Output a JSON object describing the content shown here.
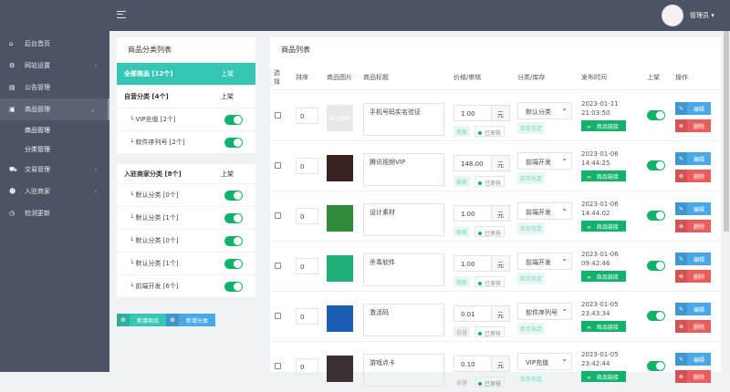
{
  "header": {
    "user": "管理员 ▾"
  },
  "sidebar": {
    "items": [
      {
        "label": "后台首页",
        "icon": "⌂",
        "name": "home",
        "chev": ""
      },
      {
        "label": "网站设置",
        "icon": "⚙",
        "name": "settings",
        "chev": "›"
      },
      {
        "label": "公告管理",
        "icon": "▤",
        "name": "notice",
        "chev": ""
      },
      {
        "label": "商品管理",
        "icon": "▣",
        "name": "goods",
        "chev": "⌄",
        "active": true
      },
      {
        "label": "交易管理",
        "icon": "⛟",
        "name": "trade",
        "chev": "›"
      },
      {
        "label": "入驻商家",
        "icon": "☻",
        "name": "merchant",
        "chev": "›"
      },
      {
        "label": "检测更新",
        "icon": "◷",
        "name": "update",
        "chev": ""
      }
    ],
    "sub": [
      "商品管理",
      "分类管理"
    ]
  },
  "category_card": {
    "title": "商品分类列表",
    "all": {
      "label": "全部商品 [12个]",
      "status": "上架"
    },
    "self": {
      "label": "自营分类 [4个]",
      "status": "上架",
      "children": [
        "└ VIP充值 [2个]",
        "└ 软件序列号 [2个]"
      ]
    },
    "merchant": {
      "label": "入驻商家分类 [8个]",
      "status": "上架",
      "children": [
        "└ 默认分类 [0个]",
        "└ 默认分类 [1个]",
        "└ 默认分类 [0个]",
        "└ 默认分类 [1个]",
        "└ 前端开发 [6个]"
      ]
    },
    "add_goods": "新增商品",
    "add_category": "新增分类"
  },
  "goods_card": {
    "title": "商品列表",
    "columns": [
      "选择",
      "排序",
      "商品图片",
      "商品标题",
      "价格/审核",
      "分类/库存",
      "发布时间",
      "上架",
      "操作"
    ],
    "unit": "元",
    "edit": "编辑",
    "delete": "删除",
    "link": "商品链接",
    "audit": "已审核",
    "stock": "库存充足",
    "rows": [
      {
        "sort": "0",
        "title": "手机号码实名验证",
        "price": "1.00",
        "source": "商家",
        "category": "默认分类",
        "date": "2023-01-11",
        "time": "21:03:50",
        "thumb": "默认图片",
        "color": "#e8e8e8"
      },
      {
        "sort": "0",
        "title": "腾讯视频VIP",
        "price": "148.00",
        "source": "商家",
        "category": "前端开发",
        "date": "2023-01-06",
        "time": "14:44:25",
        "thumb": "",
        "color": "#3a2220"
      },
      {
        "sort": "0",
        "title": "设计素材",
        "price": "1.00",
        "source": "商家",
        "category": "前端开发",
        "date": "2023-01-06",
        "time": "14:44:02",
        "thumb": "",
        "color": "#2f8a3a"
      },
      {
        "sort": "0",
        "title": "杀毒软件",
        "price": "1.00",
        "source": "商家",
        "category": "前端开发",
        "date": "2023-01-06",
        "time": "09:42:46",
        "thumb": "",
        "color": "#1fae78"
      },
      {
        "sort": "0",
        "title": "激活码",
        "price": "0.01",
        "source": "自营",
        "category": "软件序列号",
        "date": "2023-01-05",
        "time": "23:43:34",
        "thumb": "",
        "color": "#1b5fb5"
      },
      {
        "sort": "0",
        "title": "游戏点卡",
        "price": "0.10",
        "source": "自营",
        "category": "VIP充值",
        "date": "2023-01-05",
        "time": "23:42:44",
        "thumb": "",
        "color": "#3a3030"
      }
    ]
  }
}
